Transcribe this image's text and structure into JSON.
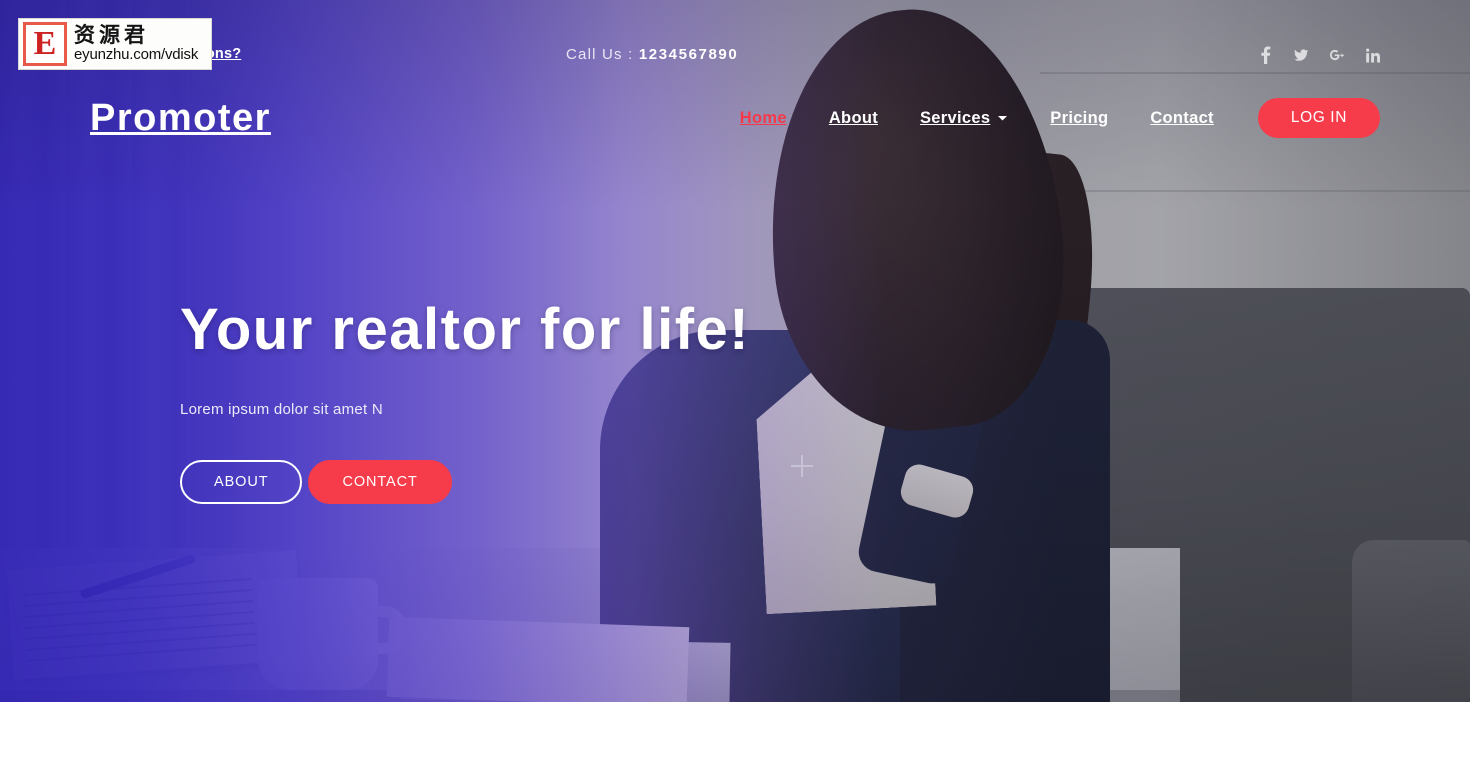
{
  "topbar": {
    "questions_link": "Have any Quastions?",
    "call_label": "Call Us :",
    "phone": "1234567890",
    "socials": [
      {
        "name": "facebook-icon",
        "label": "Facebook"
      },
      {
        "name": "twitter-icon",
        "label": "Twitter"
      },
      {
        "name": "google-plus-icon",
        "label": "Google Plus"
      },
      {
        "name": "linkedin-icon",
        "label": "LinkedIn"
      }
    ]
  },
  "navbar": {
    "brand": "Promoter",
    "links": [
      {
        "label": "Home",
        "active": true
      },
      {
        "label": "About",
        "active": false
      },
      {
        "label": "Services",
        "active": false,
        "has_dropdown": true
      },
      {
        "label": "Pricing",
        "active": false
      },
      {
        "label": "Contact",
        "active": false
      }
    ],
    "login_label": "LOG IN"
  },
  "hero": {
    "title": "Your realtor for life!",
    "subtitle": "Lorem ipsum dolor sit amet N",
    "primary_button": "ABOUT",
    "secondary_button": "CONTACT"
  },
  "watermark": {
    "initial": "E",
    "chinese": "资源君",
    "url": "eyunzhu.com/vdisk"
  },
  "colors": {
    "accent_red": "#f63b4a",
    "overlay_indigo": "#2e20b2",
    "nav_active": "#f6394b",
    "text_white": "#ffffff",
    "right_dark": "#4c4c52"
  }
}
